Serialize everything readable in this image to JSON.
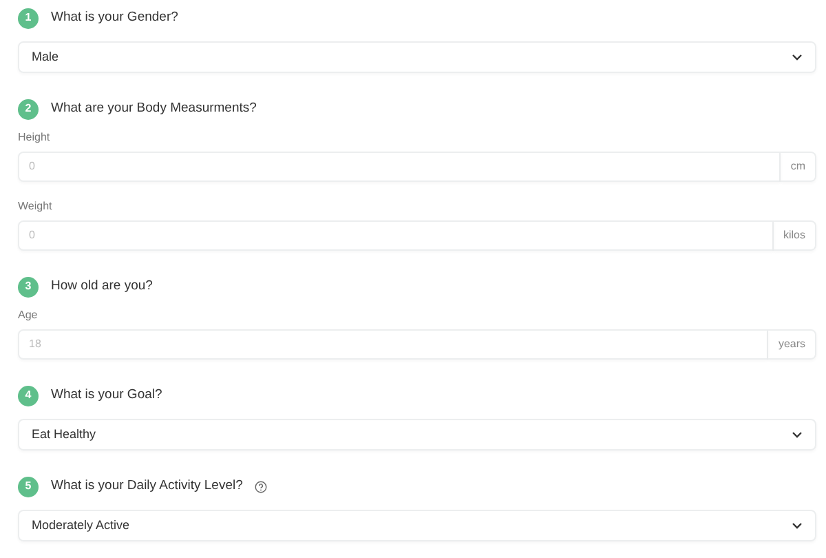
{
  "questions": [
    {
      "number": "1",
      "title": "What is your Gender?",
      "help": false,
      "kind": "select",
      "value": "Male"
    },
    {
      "number": "2",
      "title": "What are your Body Measurments?",
      "help": false,
      "kind": "inputs",
      "fields": [
        {
          "label": "Height",
          "placeholder": "0",
          "unit": "cm"
        },
        {
          "label": "Weight",
          "placeholder": "0",
          "unit": "kilos"
        }
      ]
    },
    {
      "number": "3",
      "title": "How old are you?",
      "help": false,
      "kind": "inputs",
      "fields": [
        {
          "label": "Age",
          "placeholder": "18",
          "unit": "years"
        }
      ]
    },
    {
      "number": "4",
      "title": "What is your Goal?",
      "help": false,
      "kind": "select",
      "value": "Eat Healthy"
    },
    {
      "number": "5",
      "title": "What is your Daily Activity Level?",
      "help": true,
      "kind": "select",
      "value": "Moderately Active"
    }
  ]
}
